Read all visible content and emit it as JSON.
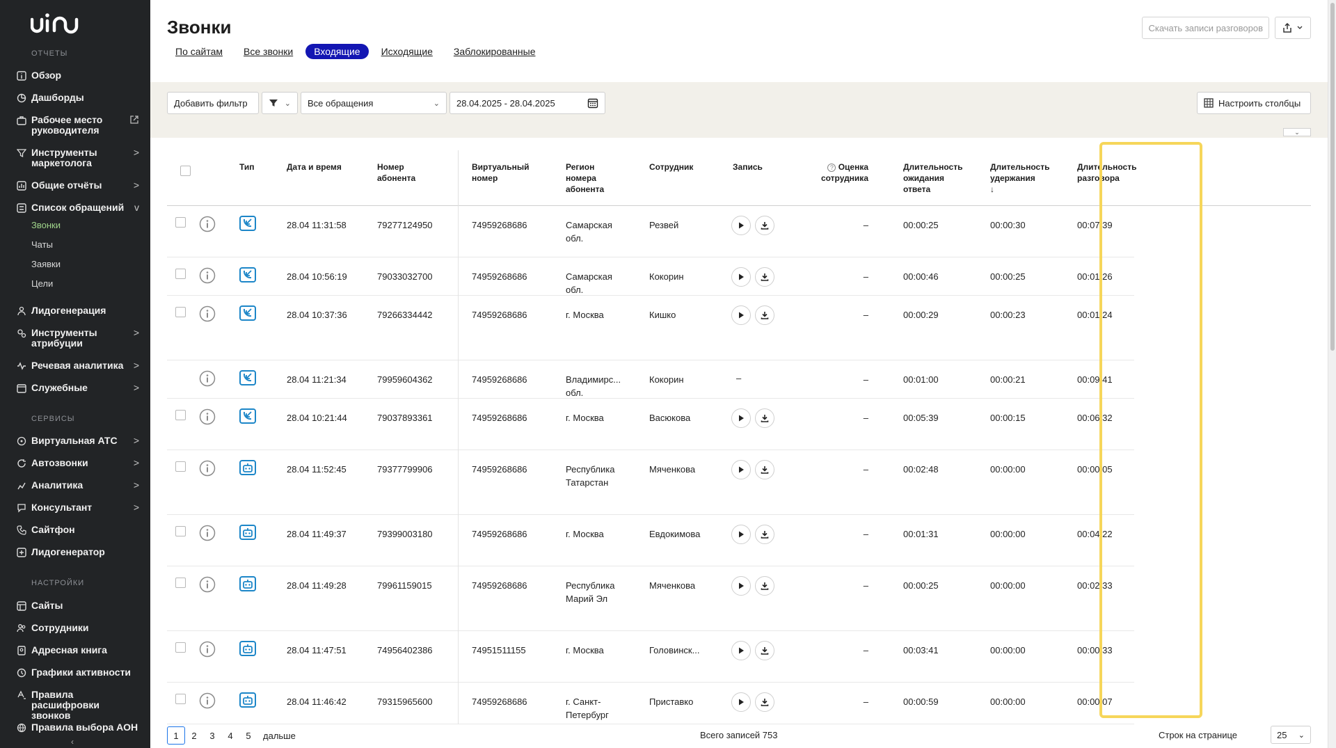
{
  "sidebar": {
    "logo": "uiin",
    "sections": {
      "reports": "ОТЧЕТЫ",
      "services": "СЕРВИСЫ",
      "settings": "НАСТРОЙКИ"
    },
    "items": {
      "overview": "Обзор",
      "dashboards": "Дашборды",
      "manager_workplace": "Рабочее место руководителя",
      "marketing_tools": "Инструменты маркетолога",
      "general_reports": "Общие отчёты",
      "requests_list": "Список обращений",
      "lead_generation": "Лидогенерация",
      "attribution_tools": "Инструменты атрибуции",
      "speech_analytics": "Речевая аналитика",
      "service": "Служебные",
      "virtual_pbx": "Виртуальная АТС",
      "autocalls": "Автозвонки",
      "analytics": "Аналитика",
      "consultant": "Консультант",
      "sitephone": "Сайтфон",
      "lead_generator": "Лидогенератор",
      "sites": "Сайты",
      "employees": "Сотрудники",
      "address_book": "Адресная книга",
      "activity_schedules": "Графики активности",
      "transcription_rules": "Правила расшифровки звонков",
      "caller_id_rules": "Правила выбора АОН"
    },
    "subitems": {
      "calls": "Звонки",
      "chats": "Чаты",
      "requests": "Заявки",
      "goals": "Цели"
    },
    "chevron": ">",
    "chevron_open": "v",
    "collapse": "‹"
  },
  "header": {
    "title": "Звонки",
    "download_records": "Скачать записи разговоров",
    "tabs": [
      "По сайтам",
      "Все звонки",
      "Входящие",
      "Исходящие",
      "Заблокированные"
    ]
  },
  "filters": {
    "add_filter": "Добавить фильтр",
    "requests_select": "Все обращения",
    "date_range": "28.04.2025 - 28.04.2025",
    "configure_columns": "Настроить столбцы"
  },
  "table": {
    "headers": {
      "type": "Тип",
      "datetime": "Дата и время",
      "subscriber": "Номер абонента",
      "virtual": "Виртуальный номер",
      "region": "Регион номера абонента",
      "employee": "Сотрудник",
      "record": "Запись",
      "rating": "Оценка сотрудника",
      "wait": "Длительность ожидания ответа",
      "hold": "Длительность удержания",
      "talk": "Длительность разговора"
    },
    "sort_indicator": "↓",
    "rows": [
      {
        "type": "in",
        "datetime": "28.04 11:31:58",
        "subscriber": "79277124950",
        "virtual": "74959268686",
        "region": "Самарская обл.",
        "employee": "Резвей",
        "rating": "–",
        "wait": "00:00:25",
        "hold": "00:00:30",
        "talk": "00:07:39",
        "has_record": true,
        "has_checkbox": true
      },
      {
        "type": "in",
        "datetime": "28.04 10:56:19",
        "subscriber": "79033032700",
        "virtual": "74959268686",
        "region": "Самарская обл.",
        "employee": "Кокорин",
        "rating": "–",
        "wait": "00:00:46",
        "hold": "00:00:25",
        "talk": "00:01:26",
        "has_record": true,
        "has_checkbox": true
      },
      {
        "type": "in",
        "datetime": "28.04 10:37:36",
        "subscriber": "79266334442",
        "virtual": "74959268686",
        "region": "г. Москва",
        "employee": "Кишко",
        "rating": "–",
        "wait": "00:00:29",
        "hold": "00:00:23",
        "talk": "00:01:24",
        "has_record": true,
        "has_checkbox": true
      },
      {
        "type": "in",
        "datetime": "28.04 11:21:34",
        "subscriber": "79959604362",
        "virtual": "74959268686",
        "region": "Владимирс... обл.",
        "employee": "Кокорин",
        "rating": "–",
        "wait": "00:01:00",
        "hold": "00:00:21",
        "talk": "00:09:41",
        "has_record": false,
        "record_text": "–",
        "has_checkbox": false
      },
      {
        "type": "in",
        "datetime": "28.04 10:21:44",
        "subscriber": "79037893361",
        "virtual": "74959268686",
        "region": "г. Москва",
        "employee": "Васюкова",
        "rating": "–",
        "wait": "00:05:39",
        "hold": "00:00:15",
        "talk": "00:06:32",
        "has_record": true,
        "has_checkbox": true
      },
      {
        "type": "bot",
        "datetime": "28.04 11:52:45",
        "subscriber": "79377799906",
        "virtual": "74959268686",
        "region": "Республика Татарстан",
        "employee": "Мяченкова",
        "rating": "–",
        "wait": "00:02:48",
        "hold": "00:00:00",
        "talk": "00:00:05",
        "has_record": true,
        "has_checkbox": true
      },
      {
        "type": "bot",
        "datetime": "28.04 11:49:37",
        "subscriber": "79399003180",
        "virtual": "74959268686",
        "region": "г. Москва",
        "employee": "Евдокимова",
        "rating": "–",
        "wait": "00:01:31",
        "hold": "00:00:00",
        "talk": "00:04:22",
        "has_record": true,
        "has_checkbox": true
      },
      {
        "type": "bot",
        "datetime": "28.04 11:49:28",
        "subscriber": "79961159015",
        "virtual": "74959268686",
        "region": "Республика Марий Эл",
        "employee": "Мяченкова",
        "rating": "–",
        "wait": "00:00:25",
        "hold": "00:00:00",
        "talk": "00:02:33",
        "has_record": true,
        "has_checkbox": true
      },
      {
        "type": "bot",
        "datetime": "28.04 11:47:51",
        "subscriber": "74956402386",
        "virtual": "74951511155",
        "region": "г. Москва",
        "employee": "Головинск...",
        "rating": "–",
        "wait": "00:03:41",
        "hold": "00:00:00",
        "talk": "00:00:33",
        "has_record": true,
        "has_checkbox": true
      },
      {
        "type": "bot",
        "datetime": "28.04 11:46:42",
        "subscriber": "79315965600",
        "virtual": "74959268686",
        "region": "г. Санкт-Петербург",
        "employee": "Приставко",
        "rating": "–",
        "wait": "00:00:59",
        "hold": "00:00:00",
        "talk": "00:00:07",
        "has_record": true,
        "has_checkbox": true
      }
    ]
  },
  "pagination": {
    "pages": [
      "1",
      "2",
      "3",
      "4",
      "5"
    ],
    "next": "дальше",
    "total": "Всего записей 753",
    "rows_per_page_label": "Строк на странице",
    "rows_per_page": "25"
  }
}
